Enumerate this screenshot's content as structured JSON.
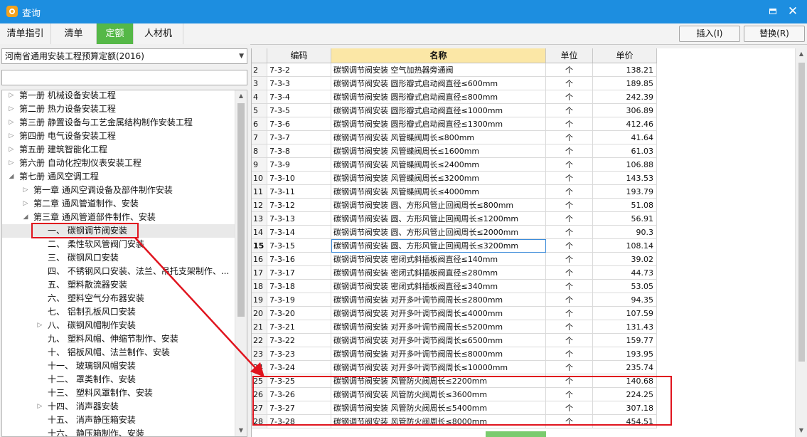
{
  "window": {
    "title": "查询",
    "maximize_icon": "maximize-icon",
    "close_icon": "close-icon",
    "close_glyph": "✕"
  },
  "tabs": [
    {
      "label": "清单指引",
      "active": false
    },
    {
      "label": "清单",
      "active": false
    },
    {
      "label": "定额",
      "active": true
    },
    {
      "label": "人材机",
      "active": false
    }
  ],
  "toolbar": {
    "insert_label": "插入(I)",
    "replace_label": "替换(R)"
  },
  "left": {
    "quota_select": "河南省通用安装工程预算定额(2016)",
    "search_value": "",
    "tree": [
      {
        "label": "第一册 机械设备安装工程",
        "level": 0,
        "caret": "closed"
      },
      {
        "label": "第二册 热力设备安装工程",
        "level": 0,
        "caret": "closed"
      },
      {
        "label": "第三册 静置设备与工艺金属结构制作安装工程",
        "level": 0,
        "caret": "closed"
      },
      {
        "label": "第四册 电气设备安装工程",
        "level": 0,
        "caret": "closed"
      },
      {
        "label": "第五册 建筑智能化工程",
        "level": 0,
        "caret": "closed"
      },
      {
        "label": "第六册 自动化控制仪表安装工程",
        "level": 0,
        "caret": "closed"
      },
      {
        "label": "第七册 通风空调工程",
        "level": 0,
        "caret": "open"
      },
      {
        "label": "第一章 通风空调设备及部件制作安装",
        "level": 1,
        "caret": "closed"
      },
      {
        "label": "第二章 通风管道制作、安装",
        "level": 1,
        "caret": "closed"
      },
      {
        "label": "第三章 通风管道部件制作、安装",
        "level": 1,
        "caret": "open"
      },
      {
        "label": "一、 碳钢调节阀安装",
        "level": 2,
        "caret": "none",
        "selected": true
      },
      {
        "label": "二、 柔性软风管阀门安装",
        "level": 2,
        "caret": "none"
      },
      {
        "label": "三、 碳钢风口安装",
        "level": 2,
        "caret": "none"
      },
      {
        "label": "四、 不锈钢风口安装、法兰、吊托支架制作、...",
        "level": 2,
        "caret": "none"
      },
      {
        "label": "五、 塑料散流器安装",
        "level": 2,
        "caret": "none"
      },
      {
        "label": "六、 塑料空气分布器安装",
        "level": 2,
        "caret": "none"
      },
      {
        "label": "七、 铝制孔板风口安装",
        "level": 2,
        "caret": "none"
      },
      {
        "label": "八、 碳钢风帽制作安装",
        "level": 2,
        "caret": "closed"
      },
      {
        "label": "九、 塑料风帽、伸缩节制作、安装",
        "level": 2,
        "caret": "none"
      },
      {
        "label": "十、 铝板风帽、法兰制作、安装",
        "level": 2,
        "caret": "none"
      },
      {
        "label": "十一、 玻璃钢风帽安装",
        "level": 2,
        "caret": "none"
      },
      {
        "label": "十二、 罩类制作、安装",
        "level": 2,
        "caret": "none"
      },
      {
        "label": "十三、 塑料风罩制作、安装",
        "level": 2,
        "caret": "none"
      },
      {
        "label": "十四、 消声器安装",
        "level": 2,
        "caret": "closed"
      },
      {
        "label": "十五、 消声静压箱安装",
        "level": 2,
        "caret": "none"
      },
      {
        "label": "十六、 静压箱制作、安装",
        "level": 2,
        "caret": "none"
      }
    ]
  },
  "grid": {
    "columns": [
      "编码",
      "名称",
      "单位",
      "单价"
    ],
    "rows": [
      {
        "n": "2",
        "code": "7-3-2",
        "name": "碳钢调节阀安装 空气加热器旁通阀",
        "unit": "个",
        "price": "138.21"
      },
      {
        "n": "3",
        "code": "7-3-3",
        "name": "碳钢调节阀安装 圆形瓣式启动阀直径≤600mm",
        "unit": "个",
        "price": "189.85"
      },
      {
        "n": "4",
        "code": "7-3-4",
        "name": "碳钢调节阀安装 圆形瓣式启动阀直径≤800mm",
        "unit": "个",
        "price": "242.39"
      },
      {
        "n": "5",
        "code": "7-3-5",
        "name": "碳钢调节阀安装 圆形瓣式启动阀直径≤1000mm",
        "unit": "个",
        "price": "306.89"
      },
      {
        "n": "6",
        "code": "7-3-6",
        "name": "碳钢调节阀安装 圆形瓣式启动阀直径≤1300mm",
        "unit": "个",
        "price": "412.46"
      },
      {
        "n": "7",
        "code": "7-3-7",
        "name": "碳钢调节阀安装 风管蝶阀周长≤800mm",
        "unit": "个",
        "price": "41.64"
      },
      {
        "n": "8",
        "code": "7-3-8",
        "name": "碳钢调节阀安装 风管蝶阀周长≤1600mm",
        "unit": "个",
        "price": "61.03"
      },
      {
        "n": "9",
        "code": "7-3-9",
        "name": "碳钢调节阀安装 风管蝶阀周长≤2400mm",
        "unit": "个",
        "price": "106.88"
      },
      {
        "n": "10",
        "code": "7-3-10",
        "name": "碳钢调节阀安装 风管蝶阀周长≤3200mm",
        "unit": "个",
        "price": "143.53"
      },
      {
        "n": "11",
        "code": "7-3-11",
        "name": "碳钢调节阀安装 风管蝶阀周长≤4000mm",
        "unit": "个",
        "price": "193.79"
      },
      {
        "n": "12",
        "code": "7-3-12",
        "name": "碳钢调节阀安装 圆、方形风管止回阀周长≤800mm",
        "unit": "个",
        "price": "51.08"
      },
      {
        "n": "13",
        "code": "7-3-13",
        "name": "碳钢调节阀安装 圆、方形风管止回阀周长≤1200mm",
        "unit": "个",
        "price": "56.91"
      },
      {
        "n": "14",
        "code": "7-3-14",
        "name": "碳钢调节阀安装 圆、方形风管止回阀周长≤2000mm",
        "unit": "个",
        "price": "90.3"
      },
      {
        "n": "15",
        "code": "7-3-15",
        "name": "碳钢调节阀安装 圆、方形风管止回阀周长≤3200mm",
        "unit": "个",
        "price": "108.14",
        "current": true
      },
      {
        "n": "16",
        "code": "7-3-16",
        "name": "碳钢调节阀安装 密闭式斜插板阀直径≤140mm",
        "unit": "个",
        "price": "39.02"
      },
      {
        "n": "17",
        "code": "7-3-17",
        "name": "碳钢调节阀安装 密闭式斜插板阀直径≤280mm",
        "unit": "个",
        "price": "44.73"
      },
      {
        "n": "18",
        "code": "7-3-18",
        "name": "碳钢调节阀安装 密闭式斜插板阀直径≤340mm",
        "unit": "个",
        "price": "53.05"
      },
      {
        "n": "19",
        "code": "7-3-19",
        "name": "碳钢调节阀安装 对开多叶调节阀周长≤2800mm",
        "unit": "个",
        "price": "94.35"
      },
      {
        "n": "20",
        "code": "7-3-20",
        "name": "碳钢调节阀安装 对开多叶调节阀周长≤4000mm",
        "unit": "个",
        "price": "107.59"
      },
      {
        "n": "21",
        "code": "7-3-21",
        "name": "碳钢调节阀安装 对开多叶调节阀周长≤5200mm",
        "unit": "个",
        "price": "131.43"
      },
      {
        "n": "22",
        "code": "7-3-22",
        "name": "碳钢调节阀安装 对开多叶调节阀周长≤6500mm",
        "unit": "个",
        "price": "159.77"
      },
      {
        "n": "23",
        "code": "7-3-23",
        "name": "碳钢调节阀安装 对开多叶调节阀周长≤8000mm",
        "unit": "个",
        "price": "193.95"
      },
      {
        "n": "24",
        "code": "7-3-24",
        "name": "碳钢调节阀安装 对开多叶调节阀周长≤10000mm",
        "unit": "个",
        "price": "235.74"
      },
      {
        "n": "25",
        "code": "7-3-25",
        "name": "碳钢调节阀安装 风管防火阀周长≤2200mm",
        "unit": "个",
        "price": "140.68"
      },
      {
        "n": "26",
        "code": "7-3-26",
        "name": "碳钢调节阀安装 风管防火阀周长≤3600mm",
        "unit": "个",
        "price": "224.25"
      },
      {
        "n": "27",
        "code": "7-3-27",
        "name": "碳钢调节阀安装 风管防火阀周长≤5400mm",
        "unit": "个",
        "price": "307.18"
      },
      {
        "n": "28",
        "code": "7-3-28",
        "name": "碳钢调节阀安装 风管防火阀周长≤8000mm",
        "unit": "个",
        "price": "454.51"
      }
    ]
  },
  "annotation": {
    "color": "#e0141e",
    "arrow_icon": "red-arrow-annotation"
  }
}
